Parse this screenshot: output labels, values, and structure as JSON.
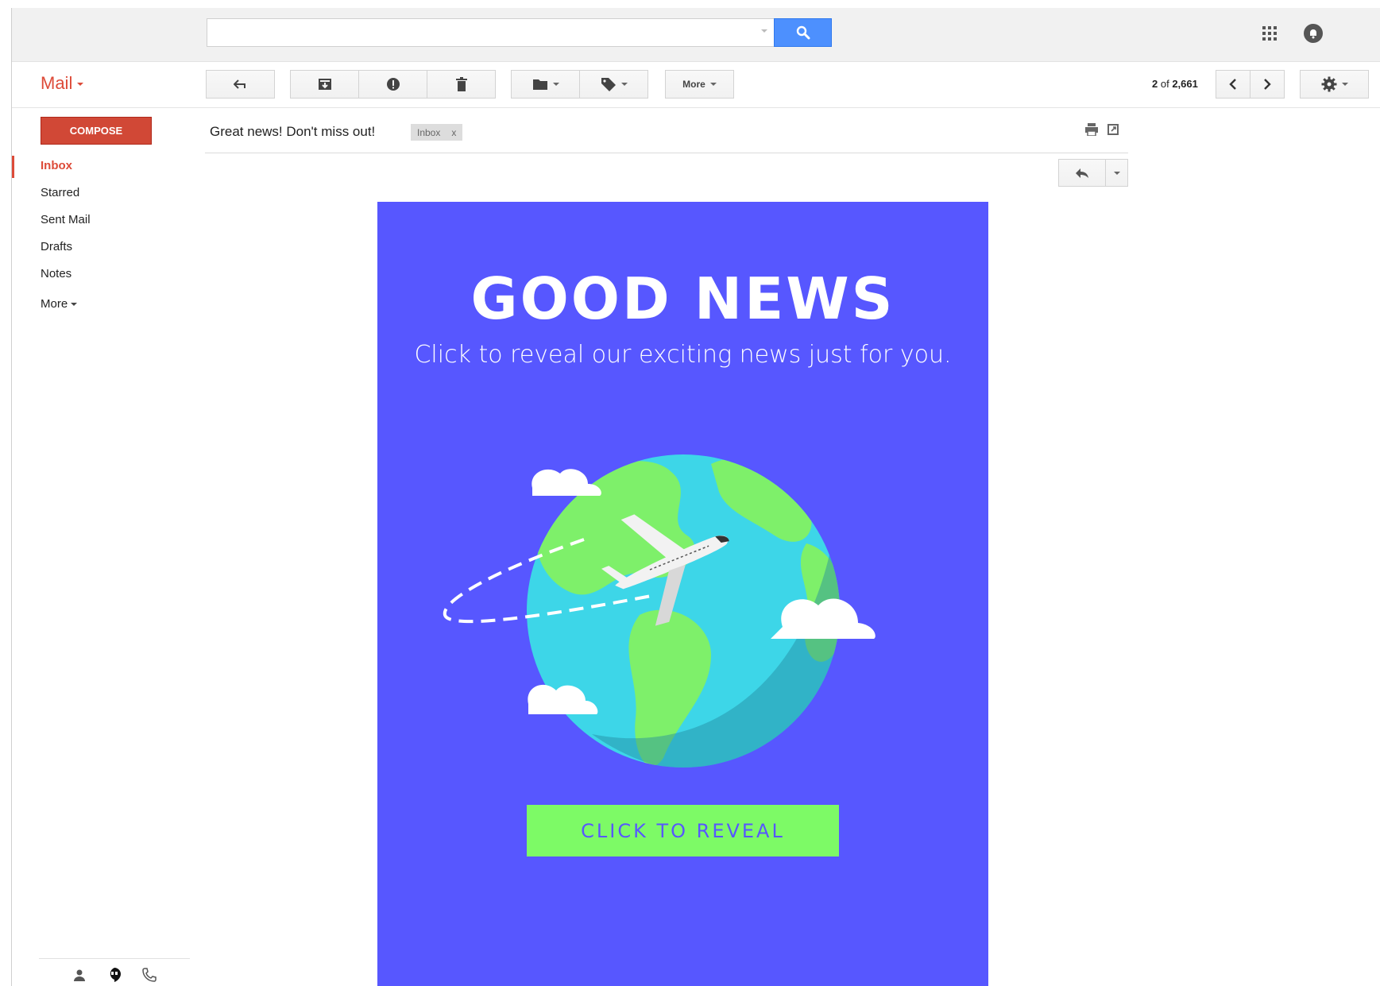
{
  "app": {
    "title": "Mail"
  },
  "search": {
    "placeholder": ""
  },
  "toolbar": {
    "more_label": "More"
  },
  "pager": {
    "current": "2",
    "sep": " of ",
    "total": "2,661"
  },
  "compose": {
    "label": "COMPOSE"
  },
  "nav": {
    "items": [
      {
        "label": "Inbox",
        "active": true
      },
      {
        "label": "Starred"
      },
      {
        "label": "Sent Mail"
      },
      {
        "label": "Drafts"
      },
      {
        "label": "Notes"
      },
      {
        "label": "More"
      }
    ]
  },
  "message": {
    "subject": "Great news! Don't miss out!",
    "label_chip": "Inbox",
    "label_chip_close": "x"
  },
  "email": {
    "headline": "GOOD NEWS",
    "tagline": "Click to reveal our exciting news just for you.",
    "cta": "CLICK TO REVEAL"
  },
  "colors": {
    "accent": "#dd4b39",
    "search_button": "#4d90fe",
    "card_bg": "#5757ff",
    "cta_bg": "#7dfa66"
  },
  "icons": [
    "search-icon",
    "apps-grid-icon",
    "notifications-icon",
    "reply-icon",
    "archive-icon",
    "report-spam-icon",
    "trash-icon",
    "folder-icon",
    "label-tag-icon",
    "chevron-left-icon",
    "chevron-right-icon",
    "gear-icon",
    "print-icon",
    "new-window-icon",
    "contacts-icon",
    "hangouts-icon",
    "phone-icon"
  ]
}
